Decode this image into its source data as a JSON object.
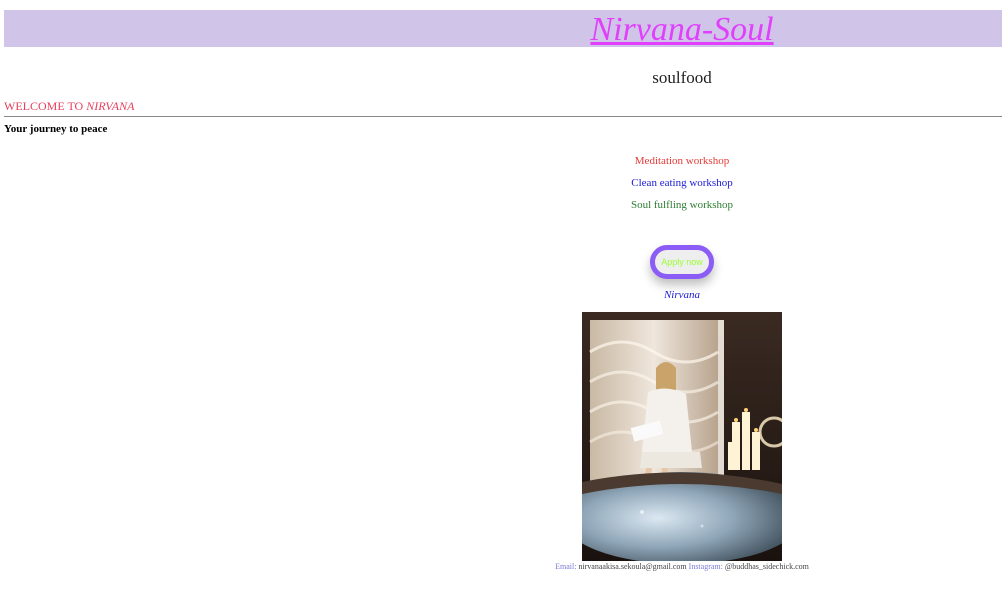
{
  "header": {
    "title": "Nirvana-Soul",
    "tagline": "soulfood"
  },
  "welcome": {
    "prefix": "WELCOME TO ",
    "name": "NIRVANA"
  },
  "intro": {
    "heading": "Your journey to peace"
  },
  "workshops": [
    {
      "label": "Meditation workshop"
    },
    {
      "label": "Clean eating workshop"
    },
    {
      "label": "Soul fulfling workshop"
    }
  ],
  "cta": {
    "label": "Apply now"
  },
  "feature": {
    "caption": "Nirvana",
    "image_description_icon": "spa-photo"
  },
  "footer": {
    "email_label": "Email:",
    "email_value": "nirvanaakisa.sekoula@gmail.com",
    "instagram_label": "Instagram:",
    "instagram_value": "@buddhas_sidechick.com"
  },
  "colors": {
    "header_bg": "#d1c4e9",
    "title": "#e040fb",
    "welcome": "#e83e5c",
    "workshop_1": "#e53935",
    "workshop_2": "#1a1ad6",
    "workshop_3": "#2e7d32",
    "button_border": "#8b5cf6",
    "button_text": "#9cff33"
  }
}
